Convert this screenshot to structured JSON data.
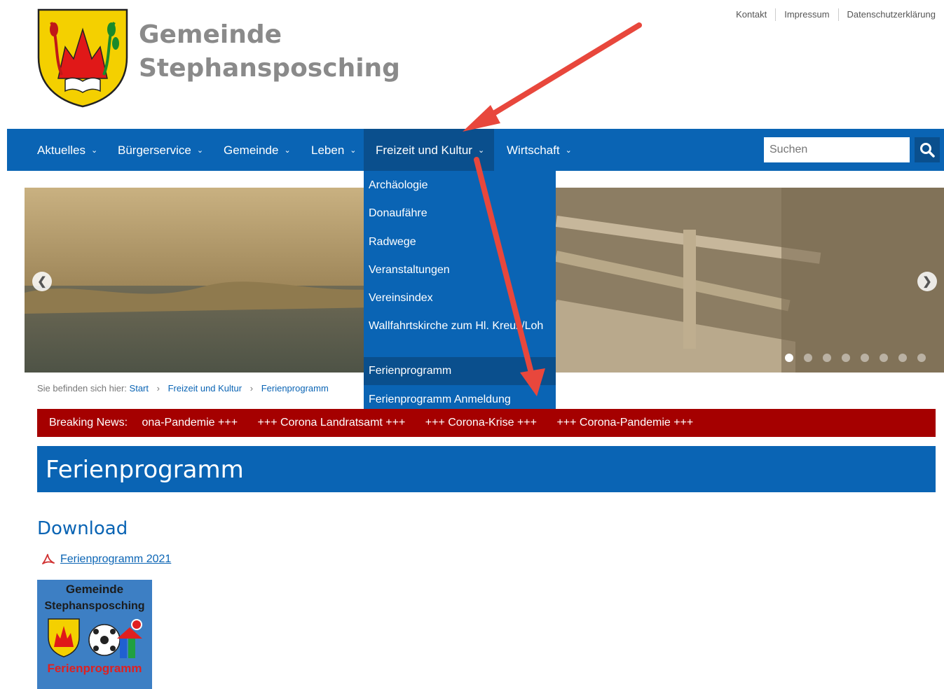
{
  "header": {
    "title_line1": "Gemeinde",
    "title_line2": "Stephansposching",
    "toplinks": [
      "Kontakt",
      "Impressum",
      "Datenschutzerklärung"
    ]
  },
  "nav": {
    "items": [
      "Aktuelles",
      "Bürgerservice",
      "Gemeinde",
      "Leben",
      "Freizeit und Kultur",
      "Wirtschaft"
    ],
    "active": "Freizeit und Kultur",
    "search_placeholder": "Suchen"
  },
  "dropdown": {
    "items": [
      "Archäologie",
      "Donaufähre",
      "Radwege",
      "Veranstaltungen",
      "Vereinsindex",
      "Wallfahrtskirche zum Hl. Kreuz/Loh",
      "Ferienprogramm",
      "Ferienprogramm Anmeldung"
    ],
    "active": "Ferienprogramm"
  },
  "breadcrumb": {
    "prefix": "Sie befinden sich hier:",
    "items": [
      "Start",
      "Freizeit und Kultur",
      "Ferienprogramm"
    ]
  },
  "news": {
    "label": "Breaking News:",
    "items": [
      "ona-Pandemie +++",
      "+++ Corona Landratsamt +++",
      "+++ Corona-Krise +++",
      "+++ Corona-Pandemie +++"
    ]
  },
  "page": {
    "title": "Ferienprogramm",
    "download_heading": "Download",
    "pdf_link": "Ferienprogramm 2021"
  },
  "logo_card": {
    "line1": "Gemeinde",
    "line2": "Stephansposching",
    "line3": "Ferienprogramm"
  },
  "colors": {
    "nav_blue": "#0a64b4",
    "nav_active": "#0a4f8d",
    "news_red": "#a50000",
    "annotation_arrow": "#e8473c"
  }
}
